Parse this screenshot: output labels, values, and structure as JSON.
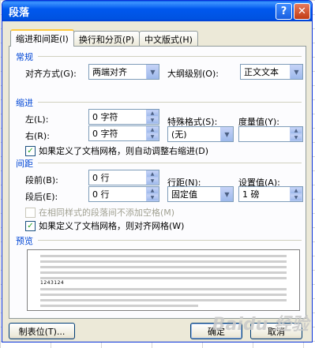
{
  "dialog": {
    "title": "段落",
    "help_button": "?",
    "close_button": "✕"
  },
  "tabs": [
    {
      "label": "缩进和间距(I)",
      "active": true
    },
    {
      "label": "换行和分页(P)",
      "active": false
    },
    {
      "label": "中文版式(H)",
      "active": false
    }
  ],
  "general": {
    "section_title": "常规",
    "alignment_label": "对齐方式(G):",
    "alignment_value": "两端对齐",
    "outline_label": "大纲级别(O):",
    "outline_value": "正文文本"
  },
  "indent": {
    "section_title": "缩进",
    "left_label": "左(L):",
    "left_value": "0 字符",
    "right_label": "右(R):",
    "right_value": "0 字符",
    "special_label": "特殊格式(S):",
    "special_value": "(无)",
    "measure_label": "度量值(Y):",
    "measure_value": "",
    "auto_adjust_label": "如果定义了文档网格，则自动调整右缩进(D)",
    "auto_adjust_checked": true
  },
  "spacing": {
    "section_title": "间距",
    "before_label": "段前(B):",
    "before_value": "0 行",
    "after_label": "段后(E):",
    "after_value": "0 行",
    "line_spacing_label": "行距(N):",
    "line_spacing_value": "固定值",
    "at_label": "设置值(A):",
    "at_value": "1 磅",
    "no_space_label": "在相同样式的段落间不添加空格(M)",
    "no_space_checked": false,
    "snap_grid_label": "如果定义了文档网格，则对齐网格(W)",
    "snap_grid_checked": true
  },
  "preview": {
    "section_title": "预览",
    "sample_text": "1243124"
  },
  "buttons": {
    "tabs": "制表位(T)...",
    "ok": "确定",
    "cancel": "取消"
  },
  "watermark": "Baidu 经验"
}
